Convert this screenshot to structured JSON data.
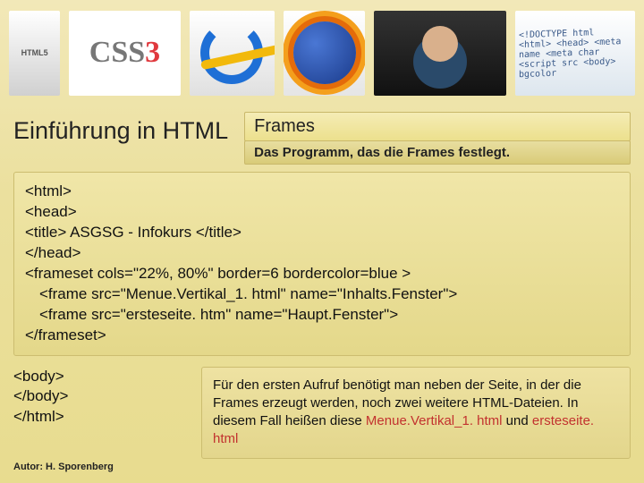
{
  "header": {
    "html5_label": "HTML5",
    "css3_prefix": "CSS",
    "css3_suffix": "3",
    "code_scribble": "<!DOCTYPE html\n<html>\n <head>\n  <meta name\n  <meta char\n <script src\n<body>\n bgcolor"
  },
  "subheader": {
    "left": "Einführung in HTML",
    "top": "Frames",
    "bottom": "Das Programm, das die Frames festlegt."
  },
  "code": {
    "l1": "<html>",
    "l2": "<head>",
    "l3": "<title> ASGSG - Infokurs  </title>",
    "l4": "</head>",
    "l5": "<frameset cols=\"22%, 80%\" border=6 bordercolor=blue >",
    "l6": "<frame src=\"Menue.Vertikal_1. html\" name=\"Inhalts.Fenster\">",
    "l7": "<frame src=\"ersteseite. htm\"   name=\"Haupt.Fenster\">",
    "l8": "</frameset>"
  },
  "code2": {
    "l1": "<body>",
    "l2": "</body>",
    "l3": "</html>"
  },
  "note": {
    "t1": "Für den ersten Aufruf benötigt man neben der Seite, in der die Frames erzeugt werden, noch zwei weitere HTML-Dateien. In diesem Fall heißen diese ",
    "f1": "Menue.Vertikal_1. html",
    "t2": " und ",
    "f2": "ersteseite. html"
  },
  "footer": "Autor: H. Sporenberg"
}
